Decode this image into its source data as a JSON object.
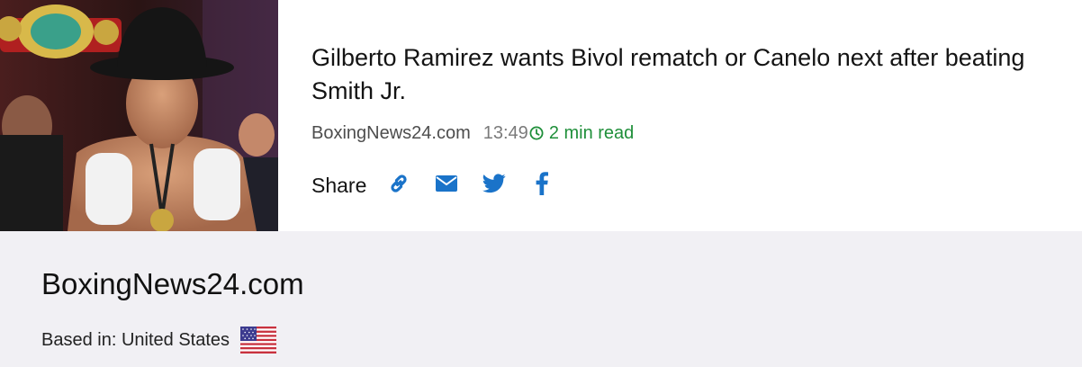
{
  "article": {
    "image_alt": "Boxer wearing a cowboy hat and championship belt",
    "title": "Gilberto Ramirez wants Bivol rematch or Canelo next after beating Smith Jr.",
    "source": "BoxingNews24.com",
    "time": "13:49",
    "read_time": "2 min read",
    "share_label": "Share",
    "share_icons": [
      "link-icon",
      "envelope-icon",
      "twitter-icon",
      "facebook-icon"
    ]
  },
  "publisher": {
    "name": "BoxingNews24.com",
    "based_in_label": "Based in: United States",
    "flag_icon": "us-flag-icon"
  },
  "colors": {
    "accent_blue": "#1a73c9",
    "read_green": "#1f8f3a",
    "footer_bg": "#f1f0f4"
  }
}
